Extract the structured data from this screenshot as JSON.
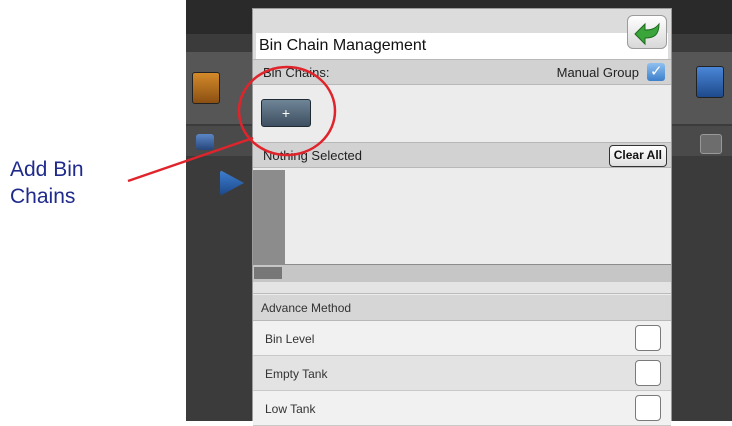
{
  "callout": {
    "text": "Add Bin Chains"
  },
  "dialog": {
    "title": "Bin Chain Management",
    "bin_chains_label": "Bin Chains:",
    "manual_group_label": "Manual Group",
    "add_button_label": "+",
    "selection_label": "Nothing Selected",
    "clear_all_label": "Clear All",
    "advance_method": {
      "header": "Advance Method",
      "options": [
        {
          "label": "Bin Level",
          "checked": false
        },
        {
          "label": "Empty Tank",
          "checked": false
        },
        {
          "label": "Low Tank",
          "checked": false
        }
      ]
    }
  },
  "colors": {
    "annotation": "#e0242b",
    "callout_text": "#1f2a8c",
    "dialog_bg": "#ececec",
    "header_bg": "#d2d2d2",
    "back_arrow": "#3aa53a"
  }
}
